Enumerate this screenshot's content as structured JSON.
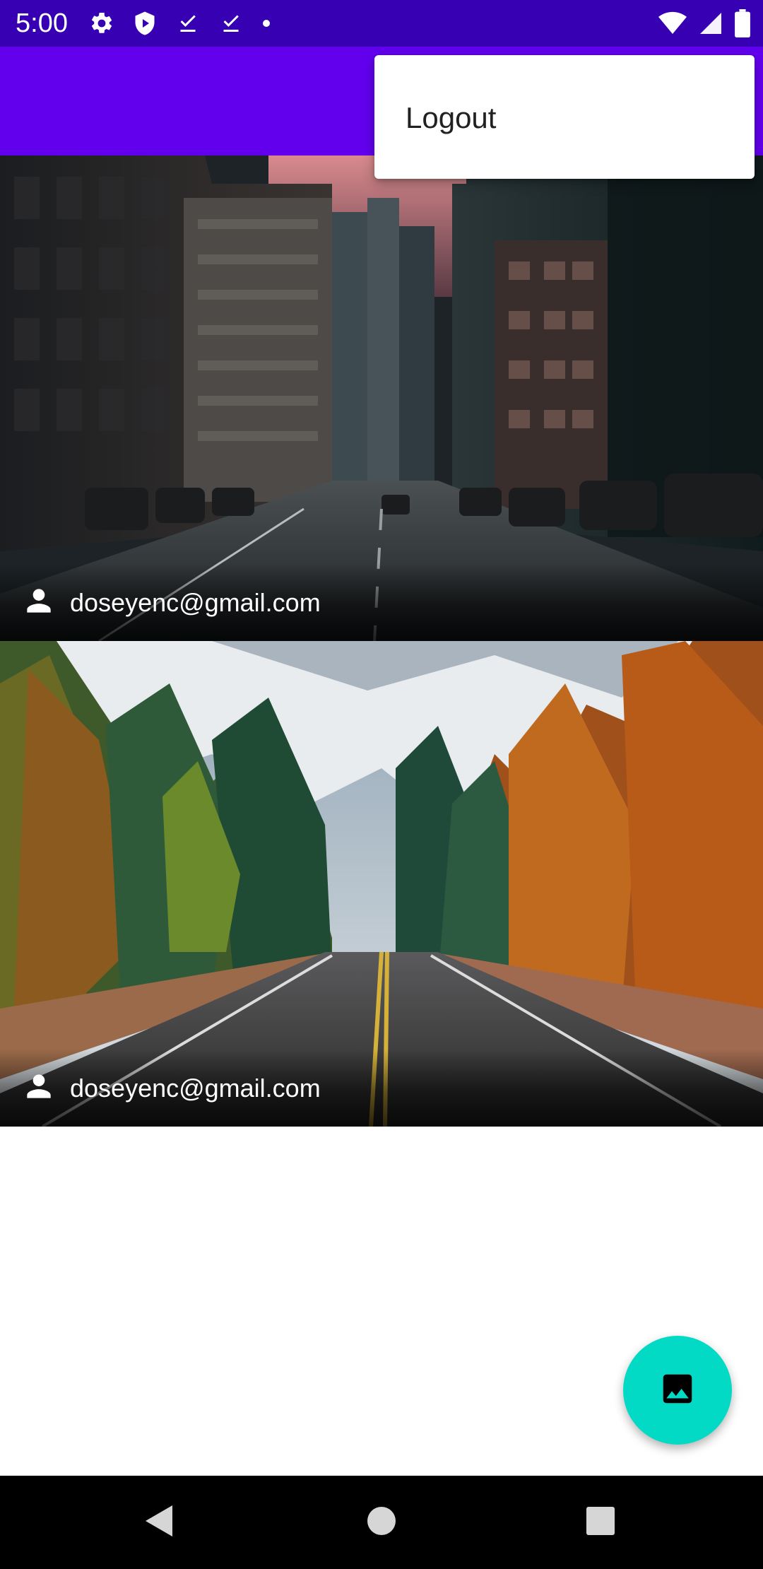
{
  "status_bar": {
    "time": "5:00",
    "left_icons": [
      "settings-icon",
      "shield-icon",
      "download-done-icon",
      "download-done-icon",
      "dot-icon"
    ],
    "right_icons": [
      "wifi-icon",
      "signal-icon",
      "battery-icon"
    ]
  },
  "app_bar": {
    "color": "#6200EE"
  },
  "menu": {
    "items": [
      {
        "label": "Logout"
      }
    ]
  },
  "feed": {
    "posts": [
      {
        "user_email": "doseyenc@gmail.com",
        "image": "city-street-photo"
      },
      {
        "user_email": "doseyenc@gmail.com",
        "image": "forest-road-photo"
      }
    ]
  },
  "fab": {
    "icon": "image-icon",
    "color": "#03DAC5"
  },
  "nav_bar": {
    "buttons": [
      "back-icon",
      "home-icon",
      "recents-icon"
    ]
  }
}
